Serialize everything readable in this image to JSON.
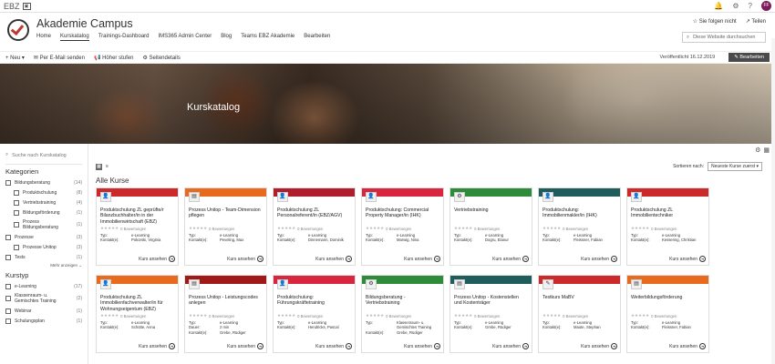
{
  "topbar": {
    "brand": "EBZ",
    "avatar": "FF"
  },
  "site": {
    "title": "Akademie Campus",
    "nav": [
      "Home",
      "Kurskatalog",
      "Trainings-Dashboard",
      "IMS365 Admin Center",
      "Blog",
      "Teams EBZ Akademie",
      "Bearbeiten"
    ],
    "active_nav": "Kurskatalog",
    "follow": "Sie folgen nicht",
    "share": "Teilen",
    "search_placeholder": "Diese Website durchsuchen"
  },
  "commandbar": {
    "new": "Neu",
    "email": "Per E-Mail senden",
    "promote": "Höher stufen",
    "details": "Seitendetails",
    "published": "Veröffentlicht 16.12.2019",
    "edit": "Bearbeiten"
  },
  "hero": {
    "title": "Kurskatalog"
  },
  "filters": {
    "search_placeholder": "Suche nach Kurskatalog",
    "categories_title": "Kategorien",
    "categories": [
      {
        "label": "Bildungsberatung",
        "count": "(14)",
        "level": 0
      },
      {
        "label": "Produktschulung",
        "count": "(8)",
        "level": 1
      },
      {
        "label": "Vertriebstraining",
        "count": "(4)",
        "level": 1
      },
      {
        "label": "Bildungsförderung",
        "count": "(1)",
        "level": 1
      },
      {
        "label": "Prozess Bildungsberatung",
        "count": "(1)",
        "level": 2
      },
      {
        "label": "Prozesse",
        "count": "(3)",
        "level": 0
      },
      {
        "label": "Prozesse Unitop",
        "count": "(3)",
        "level": 1
      },
      {
        "label": "Tests",
        "count": "(1)",
        "level": 0
      }
    ],
    "more": "Mehr anzeigen",
    "kurstyp_title": "Kurstyp",
    "kurstyp": [
      {
        "label": "e-Learning",
        "count": "(17)"
      },
      {
        "label": "Klassenraum- u. Gemischtes Training",
        "count": "(2)"
      },
      {
        "label": "Webinar",
        "count": "(1)"
      },
      {
        "label": "Schulungsplan",
        "count": "(1)"
      }
    ]
  },
  "catalog": {
    "section_title": "Alle Kurse",
    "sort_label": "Sortieren nach:",
    "sort_value": "Neueste Kurse zuerst",
    "ratings_text": "0 Bewertungen",
    "stars": "★★★★★",
    "typ_label": "Typ:",
    "dauer_label": "Dauer:",
    "kontakt_label": "Kontakt(e):",
    "link_label": "Kurs ansehen",
    "cards": [
      {
        "title": "Produktschulung ZL geprüfte/r Bilanzbuchhalter/in in der Immobilienwirtschaft (EBZ)",
        "type": "e-Learning",
        "contact": "Pokorski, Virginia",
        "bar_color": "#cc2a2a",
        "thumb": "a"
      },
      {
        "title": "Prozess Unitop - Team-Dimension pflegen",
        "type": "e-Learning",
        "contact": "Peveling, Max",
        "bar_color": "#e86a1c",
        "thumb": "b"
      },
      {
        "title": "Produktschulung ZL Personalreferent/in (EBZ/AGV)",
        "type": "e-Learning",
        "contact": "Dinnemann, Dominik",
        "bar_color": "#b01e2e",
        "thumb": "a"
      },
      {
        "title": "Produktschulung: Commercial Property Manager/in (IHK)",
        "type": "e-Learning",
        "contact": "Marwig, Nina",
        "bar_color": "#d7263d",
        "thumb": "a"
      },
      {
        "title": "Vertriebstraining",
        "type": "e-Learning",
        "contact": "Dogru, Elanur",
        "bar_color": "#2e8b3a",
        "thumb": "c"
      },
      {
        "title": "Produktschulung: Immobilienmakler/in (IHK)",
        "type": "e-Learning",
        "contact": "Fleissner, Fabian",
        "bar_color": "#1f5c5c",
        "thumb": "a"
      },
      {
        "title": "Produktschulung ZL Immobilientechniker",
        "type": "e-Learning",
        "contact": "Kessering, Christian",
        "bar_color": "#cc2a2a",
        "thumb": "a"
      },
      {
        "title": "Produktschulung ZL Immobilienfachverwalter/in für Wohnungseigentum (EBZ)",
        "type": "e-Learning",
        "contact": "Schütte, Anna",
        "bar_color": "#e86a1c",
        "thumb": "a"
      },
      {
        "title": "Prozess Unitop - Leistungscodes anlegen",
        "type": "e-Learning",
        "duration": "2 min",
        "contact": "Grebe, Rüdiger",
        "bar_color": "#a01818",
        "thumb": "b"
      },
      {
        "title": "Produktschulung: Führungskräftetraining",
        "type": "e-Learning",
        "contact": "Hendricks, Pascal",
        "bar_color": "#d7263d",
        "thumb": "a"
      },
      {
        "title": "Bildungsberatung - Vertriebstraining",
        "type": "Klassenraum- u. Gemischtes Training",
        "contact": "Grebe, Rüdiger",
        "bar_color": "#2e8b3a",
        "thumb": "c"
      },
      {
        "title": "Prozess Unitop - Kostenstellen und Kostenträger",
        "type": "e-Learning",
        "contact": "Grebe, Rüdiger",
        "bar_color": "#1f5c5c",
        "thumb": "b"
      },
      {
        "title": "Testkurs MaBV",
        "type": "e-Learning",
        "contact": "Maute, Stephan",
        "bar_color": "#cc2a2a",
        "thumb": "d"
      },
      {
        "title": "Weiterbildungsförderung",
        "type": "e-Learning",
        "contact": "Fleissner, Fabian",
        "bar_color": "#e86a1c",
        "thumb": "b"
      }
    ]
  }
}
